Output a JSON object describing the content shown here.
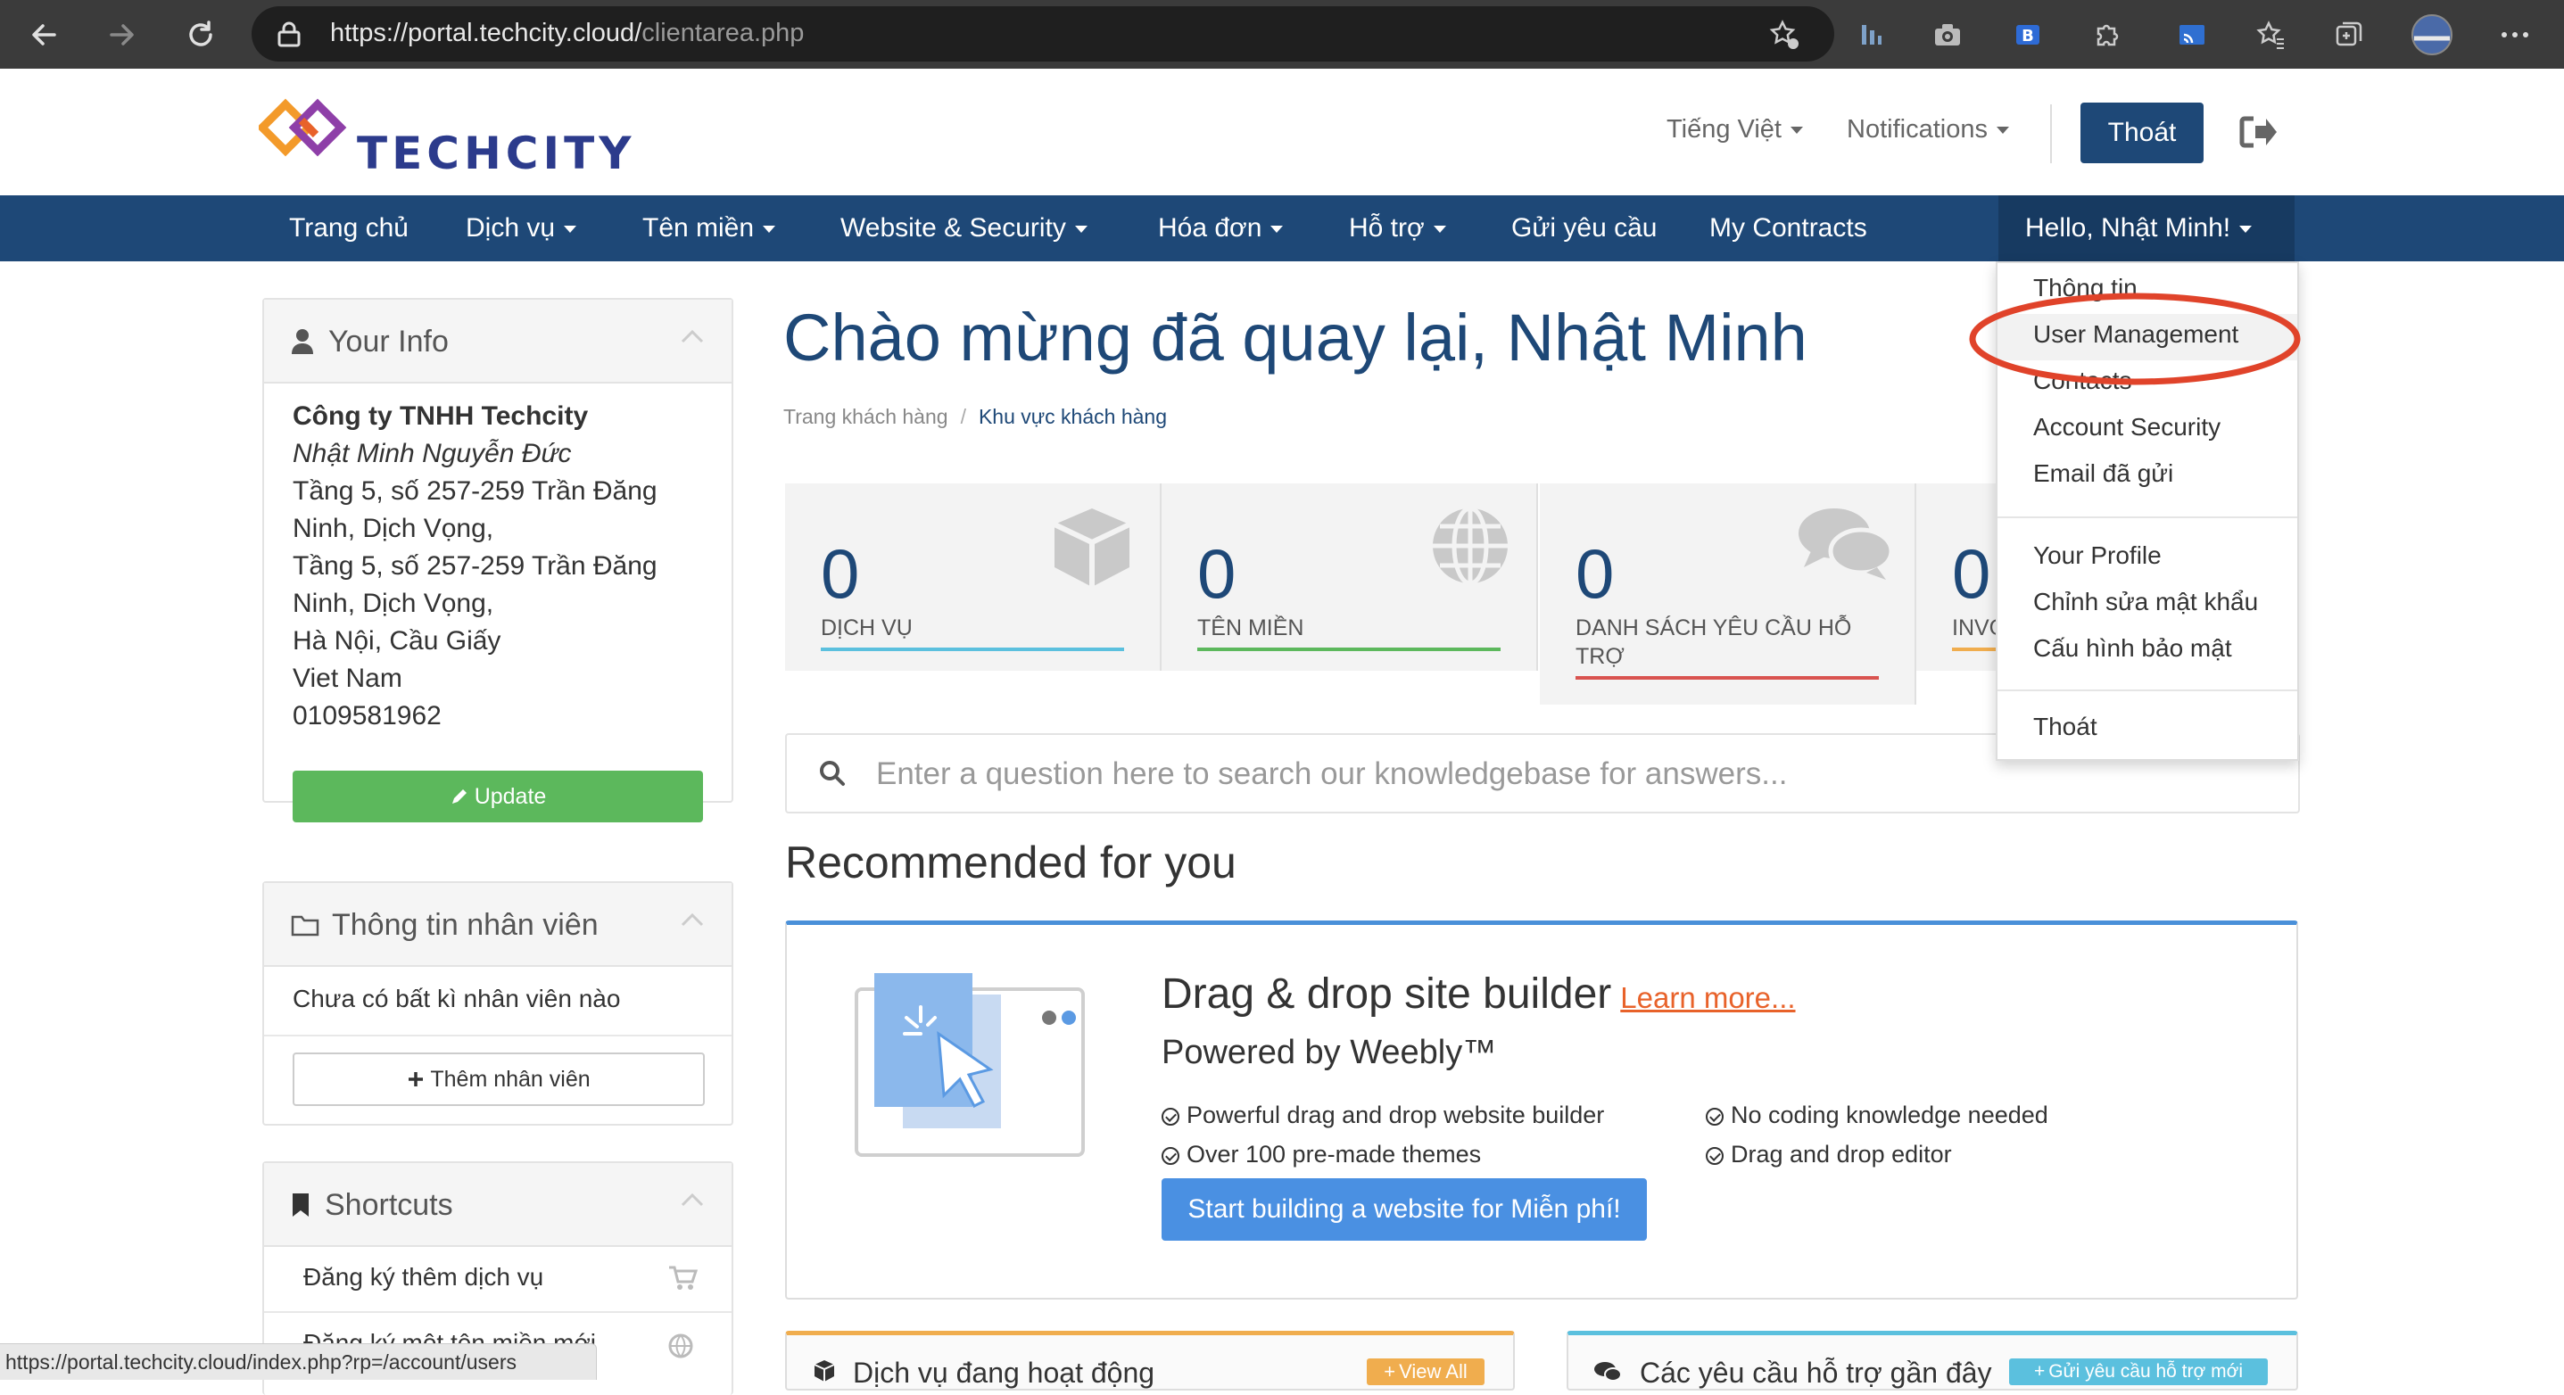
{
  "browser": {
    "url_domain": "https://portal.techcity.cloud/",
    "url_path": "clientarea.php"
  },
  "brand": {
    "logo_text": "TECHCITY",
    "primary": "#1e4877",
    "accent": "#e8622a"
  },
  "header": {
    "language": "Tiếng Việt",
    "notifications": "Notifications",
    "logout": "Thoát"
  },
  "nav": {
    "items": [
      "Trang chủ",
      "Dịch vụ",
      "Tên miền",
      "Website & Security",
      "Hóa đơn",
      "Hỗ trợ",
      "Gửi yêu cầu",
      "My Contracts"
    ],
    "account": "Hello, Nhật Minh!"
  },
  "account_menu": {
    "items": [
      "Thông tin",
      "User Management",
      "Contacts",
      "Account Security",
      "Email đã gửi",
      "Your Profile",
      "Chỉnh sửa mật khẩu",
      "Cấu hình bảo mật",
      "Thoát"
    ]
  },
  "your_info": {
    "title": "Your Info",
    "company": "Công ty TNHH Techcity",
    "name": "Nhật Minh Nguyễn Đức",
    "address": [
      "Tầng 5, số 257-259 Trần Đăng",
      "Ninh, Dịch Vọng,",
      "Tầng 5, số 257-259 Trần Đăng",
      "Ninh, Dịch Vọng,",
      "Hà Nội, Cầu Giấy",
      "Viet Nam",
      "0109581962"
    ],
    "update": "Update"
  },
  "staff": {
    "title": "Thông tin nhân viên",
    "empty": "Chưa có bất kì nhân viên nào",
    "add": "Thêm nhân viên"
  },
  "shortcuts": {
    "title": "Shortcuts",
    "items": [
      "Đăng ký thêm dịch vụ",
      "Đăng ký một tên miền mới"
    ]
  },
  "welcome": "Chào mừng đã quay lại, Nhật Minh",
  "breadcrumb": [
    "Trang khách hàng",
    "Khu vực khách hàng"
  ],
  "stats": [
    {
      "value": "0",
      "label": "DỊCH VỤ",
      "color": "#5bc0de"
    },
    {
      "value": "0",
      "label": "TÊN MIỀN",
      "color": "#5cb85c"
    },
    {
      "value": "0",
      "label": "DANH SÁCH YÊU CẦU HỖ TRỢ",
      "color": "#d9534f"
    },
    {
      "value": "0",
      "label": "INVOICES",
      "color": "#f0ad4e"
    }
  ],
  "kb_search": {
    "placeholder": "Enter a question here to search our knowledgebase for answers..."
  },
  "recommended": {
    "title": "Recommended for you",
    "promo_title": "Drag & drop site builder",
    "learn_more": "Learn more...",
    "subtitle": "Powered by Weebly™",
    "features": [
      "Powerful drag and drop website builder",
      "Over 100 pre-made themes",
      "No coding knowledge needed",
      "Drag and drop editor"
    ],
    "cta": "Start building a website for Miễn phí!"
  },
  "bottom": {
    "active_services": "Dịch vụ đang hoạt động",
    "view_all": "View All",
    "recent_tickets": "Các yêu cầu hỗ trợ gần đây",
    "new_ticket": "Gửi yêu cầu hỗ trợ mới"
  },
  "status_url": "https://portal.techcity.cloud/index.php?rp=/account/users"
}
